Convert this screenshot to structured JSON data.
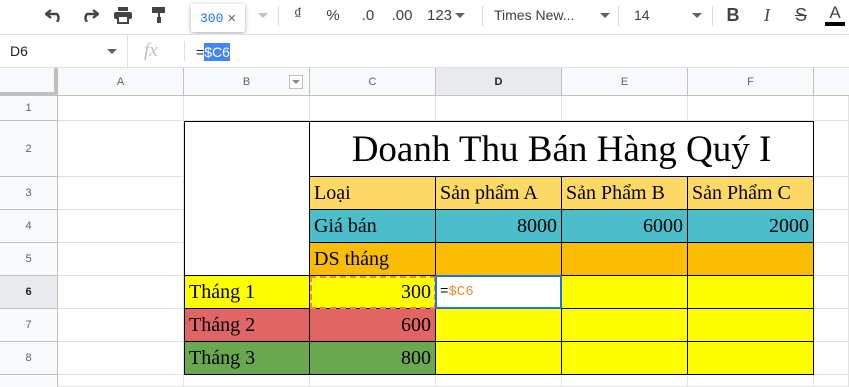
{
  "toolbar": {
    "undo_icon": "undo-icon",
    "redo_icon": "redo-icon",
    "print_icon": "print-icon",
    "paint_format_icon": "paint-format-icon",
    "tooltip_value": "300",
    "tooltip_close": "×",
    "currency_label": "₫",
    "percent_label": "%",
    "decrease_decimal_label": ".0",
    "increase_decimal_label": ".00",
    "more_formats_label": "123",
    "font_family": "Times New...",
    "font_size": "14",
    "bold_label": "B",
    "italic_label": "I",
    "strike_label": "S",
    "text_color_label": "A"
  },
  "formula_bar": {
    "name_box": "D6",
    "fx_label": "fx",
    "formula_prefix": "=",
    "formula_ref": "$C6"
  },
  "columns": [
    "A",
    "B",
    "C",
    "D",
    "E",
    "F"
  ],
  "rows": [
    "1",
    "2",
    "3",
    "4",
    "5",
    "6",
    "7",
    "8"
  ],
  "sheet": {
    "title": "Doanh Thu Bán Hàng Quý I",
    "row3": [
      "Loại",
      "Sản phẩm A",
      "Sản Phẩm B",
      "Sản Phẩm C"
    ],
    "row4": [
      "Giá bán",
      "8000",
      "6000",
      "2000"
    ],
    "row5_label": "DS tháng",
    "months": [
      "Tháng 1",
      "Tháng 2",
      "Tháng 3"
    ],
    "month_values": [
      "300",
      "600",
      "800"
    ],
    "editing_prefix": "=",
    "editing_ref": "$C6"
  },
  "colors": {
    "header_orange": "#ffd966",
    "teal": "#4bbec9",
    "orange": "#fbbc04",
    "yellow": "#ffff00",
    "red": "#e06666",
    "green": "#6aa84f",
    "selection_blue": "#1a73e8",
    "ref_orange": "#f6892e"
  }
}
